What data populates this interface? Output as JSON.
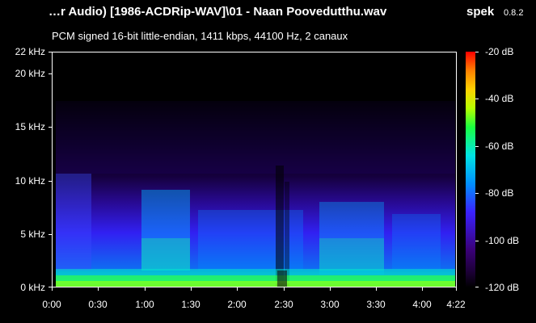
{
  "header": {
    "title": "…r Audio) [1986-ACDRip-WAV]\\01 - Naan Poovedutthu.wav",
    "app_name": "spek",
    "version": "0.8.2",
    "info": "PCM signed 16-bit little-endian, 1411 kbps, 44100 Hz, 2 canaux"
  },
  "axes": {
    "y_labels": [
      "22 kHz",
      "20 kHz",
      "15 kHz",
      "10 kHz",
      "5 kHz",
      "0 kHz"
    ],
    "x_labels": [
      "0:00",
      "0:30",
      "1:00",
      "1:30",
      "2:00",
      "2:30",
      "3:00",
      "3:30",
      "4:00",
      "4:22"
    ],
    "db_labels": [
      "-20 dB",
      "-40 dB",
      "-60 dB",
      "-80 dB",
      "-100 dB",
      "-120 dB"
    ]
  },
  "colors": {
    "background": "#000000",
    "text": "#ffffff",
    "spectrogram_low": "#3a22ff",
    "spectrogram_mid": "#00e4e4",
    "spectrogram_high": "#19ff3f"
  }
}
